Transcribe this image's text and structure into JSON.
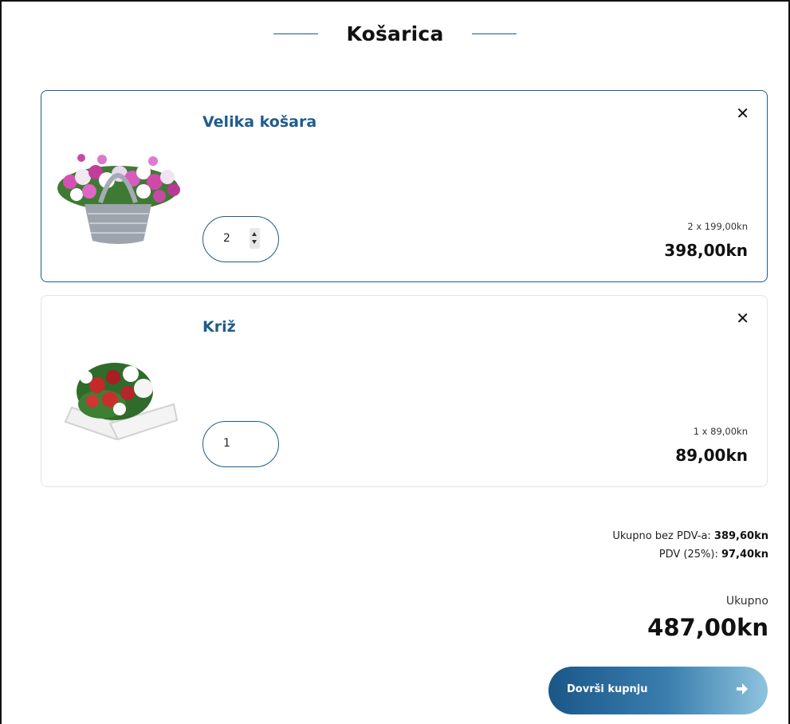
{
  "cart": {
    "title": "Košarica",
    "items": [
      {
        "name": "Velika košara",
        "image_icon": "basket-flower-arrangement-image",
        "quantity": "2",
        "unit_price_line": "2 x 199,00kn",
        "line_total": "398,00kn",
        "remove_icon": "close-icon",
        "remove_glyph": "✕",
        "active": true
      },
      {
        "name": "Križ",
        "image_icon": "cross-flower-arrangement-image",
        "quantity": "1",
        "unit_price_line": "1 x 89,00kn",
        "line_total": "89,00kn",
        "remove_icon": "close-icon",
        "remove_glyph": "✕",
        "active": false
      }
    ],
    "summary": {
      "subtotal_label": "Ukupno bez PDV-a: ",
      "subtotal_value": "389,60kn",
      "vat_label": "PDV (25%): ",
      "vat_value": "97,40kn",
      "total_label": "Ukupno",
      "total_value": "487,00kn"
    },
    "checkout": {
      "label": "Dovrši kupnju",
      "icon": "arrow-right-icon"
    }
  },
  "colors": {
    "accent": "#1d5a8c",
    "title_blue": "#1e5c8d",
    "button_gradient_start": "#1a5788",
    "button_gradient_end": "#8ec4de"
  }
}
